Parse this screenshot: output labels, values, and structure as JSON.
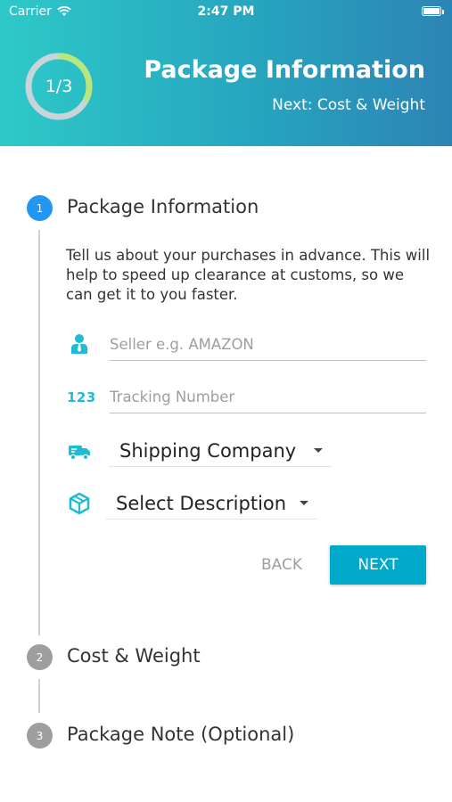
{
  "status_bar": {
    "carrier": "Carrier",
    "time": "2:47 PM"
  },
  "header": {
    "progress_label": "1/3",
    "progress_fraction": 0.33,
    "title": "Package Information",
    "subtitle": "Next: Cost & Weight",
    "gradient": [
      "#2ec9c9",
      "#2c84b4"
    ]
  },
  "steps": [
    {
      "number": "1",
      "title": "Package Information",
      "state": "active"
    },
    {
      "number": "2",
      "title": "Cost & Weight",
      "state": "inactive"
    },
    {
      "number": "3",
      "title": "Package Note (Optional)",
      "state": "inactive"
    }
  ],
  "form": {
    "description": "Tell us about your purchases in advance. This will help to speed up clearance at customs, so we can get it to you faster.",
    "seller": {
      "placeholder": "Seller e.g. AMAZON",
      "value": "",
      "icon": "seller-person-icon"
    },
    "tracking": {
      "placeholder": "Tracking Number",
      "value": "",
      "icon": "123-icon"
    },
    "shipping_company": {
      "selected": "Shipping Company",
      "icon": "delivery-truck-icon"
    },
    "description_select": {
      "selected": "Select Description",
      "icon": "package-box-icon"
    },
    "back_label": "BACK",
    "next_label": "NEXT"
  },
  "colors": {
    "accent": "#00a8c9",
    "icon": "#1fbcd3",
    "active_step": "#2196f3",
    "inactive_step": "#9e9e9e"
  }
}
